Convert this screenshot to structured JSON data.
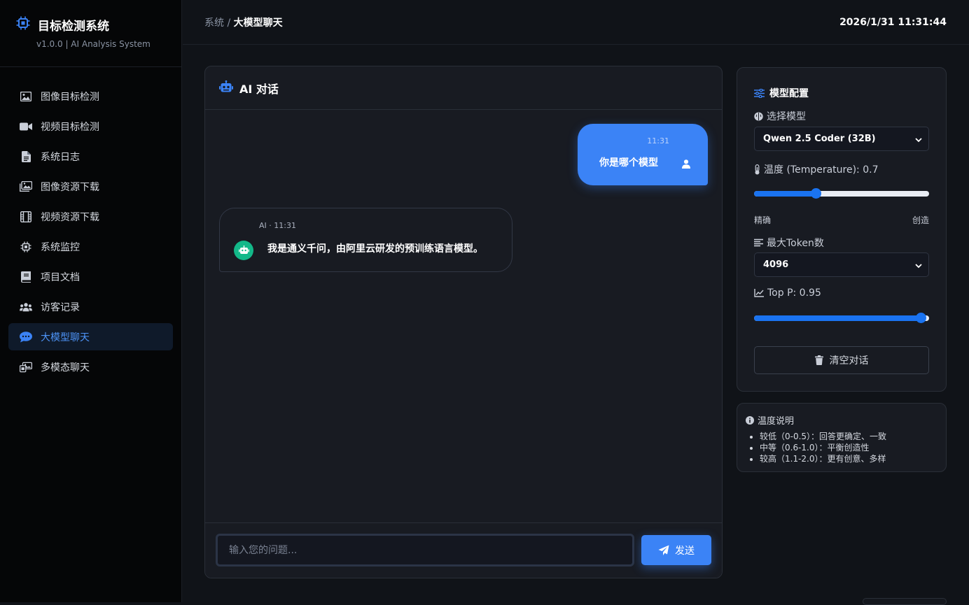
{
  "brand": {
    "title": "目标检测系统",
    "subtitle": "v1.0.0 | AI Analysis System"
  },
  "nav": {
    "items": [
      {
        "label": "图像目标检测",
        "icon": "image-icon"
      },
      {
        "label": "视频目标检测",
        "icon": "video-icon"
      },
      {
        "label": "系统日志",
        "icon": "file-icon"
      },
      {
        "label": "图像资源下载",
        "icon": "images-icon"
      },
      {
        "label": "视频资源下载",
        "icon": "film-icon"
      },
      {
        "label": "系统监控",
        "icon": "cpu-icon"
      },
      {
        "label": "项目文档",
        "icon": "book-icon"
      },
      {
        "label": "访客记录",
        "icon": "users-icon"
      },
      {
        "label": "大模型聊天",
        "icon": "chat-icon",
        "active": true
      },
      {
        "label": "多模态聊天",
        "icon": "photo-video-icon"
      }
    ]
  },
  "header": {
    "breadcrumb_root": "系统",
    "breadcrumb_sep": "/",
    "breadcrumb_current": "大模型聊天",
    "datetime": "2026/1/31 11:31:44"
  },
  "chat": {
    "title": "AI 对话",
    "messages": [
      {
        "role": "user",
        "time": "11:31",
        "text": "你是哪个模型"
      },
      {
        "role": "ai",
        "meta": "AI · 11:31",
        "text": "我是通义千问，由阿里云研发的预训练语言模型。"
      }
    ],
    "input": {
      "placeholder": "输入您的问题...",
      "value": ""
    },
    "send_label": "发送"
  },
  "config": {
    "title": "模型配置",
    "model_label": "选择模型",
    "model_value": "Qwen 2.5 Coder (32B)",
    "temperature_label": "温度 (Temperature): 0.7",
    "temperature": 0.7,
    "temperature_range": [
      0,
      2
    ],
    "temp_low": "精确",
    "temp_high": "创造",
    "max_tokens_label": "最大Token数",
    "max_tokens_value": "4096",
    "top_p_label": "Top P: 0.95",
    "top_p": 0.95,
    "clear_label": "清空对话"
  },
  "info": {
    "title": "温度说明",
    "items": [
      "较低（0-0.5）：回答更确定、一致",
      "中等（0.6-1.0）：平衡创造性",
      "较高（1.1-2.0）：更有创意、多样"
    ]
  },
  "colors": {
    "accent": "#3b83f6",
    "ai_avatar": "#13b889",
    "background": "#101318",
    "sidebar": "#050607"
  }
}
